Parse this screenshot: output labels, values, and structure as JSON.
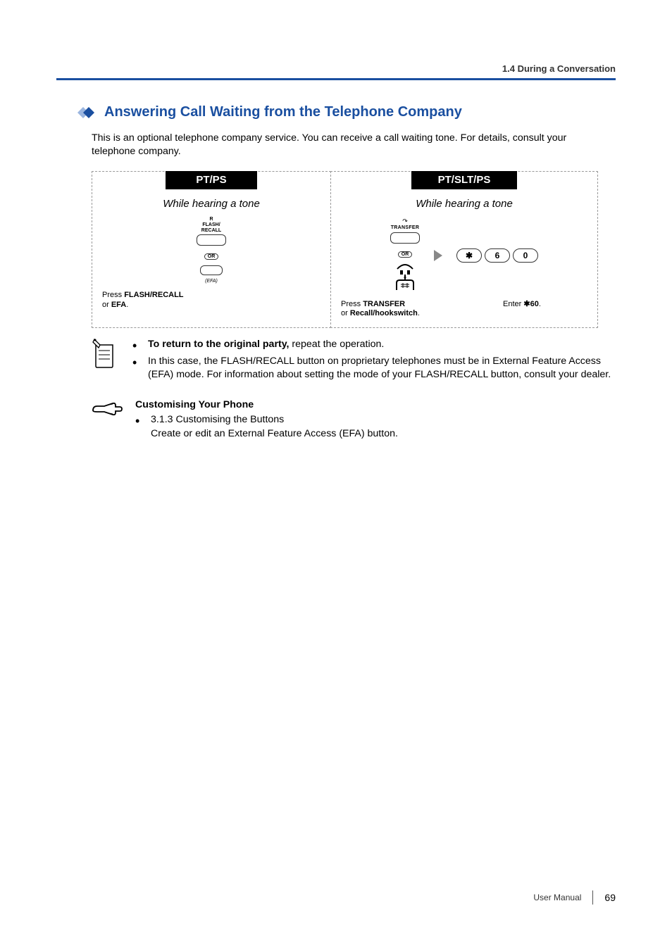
{
  "header": {
    "section_label": "1.4 During a Conversation"
  },
  "title": "Answering Call Waiting from the Telephone Company",
  "intro": "This is an optional telephone company service. You can receive a call waiting tone. For details, consult your telephone company.",
  "panel_left": {
    "header": "PT/PS",
    "sub": "While hearing a tone",
    "btn_top_line1": "R",
    "btn_top_line2": "FLASH/",
    "btn_top_line3": "RECALL",
    "or": "OR",
    "btn_bottom_label": "(EFA)",
    "cap_pre": "Press ",
    "cap_b1": "FLASH/RECALL",
    "cap_mid": " or ",
    "cap_b2": "EFA",
    "cap_end": "."
  },
  "panel_right": {
    "header": "PT/SLT/PS",
    "sub": "While hearing a tone",
    "transfer": "TRANSFER",
    "or": "OR",
    "key1": "✱",
    "key2": "6",
    "key3": "0",
    "capL_pre": "Press ",
    "capL_b1": "TRANSFER",
    "capL_mid": " or ",
    "capL_b2": "Recall/hookswitch",
    "capL_end": ".",
    "capR_pre": "Enter ",
    "capR_code": "✱60",
    "capR_end": "."
  },
  "tips": {
    "t1_lead": "To return to the original party,",
    "t1_rest": " repeat the operation.",
    "t2": "In this case, the FLASH/RECALL button on proprietary telephones must be in External Feature Access (EFA) mode. For information about setting the mode of your FLASH/RECALL button, consult your dealer."
  },
  "customise": {
    "heading": "Customising Your Phone",
    "line1": "3.1.3 Customising the Buttons",
    "line2": "Create or edit an External Feature Access (EFA) button."
  },
  "footer": {
    "label": "User Manual",
    "page": "69"
  }
}
